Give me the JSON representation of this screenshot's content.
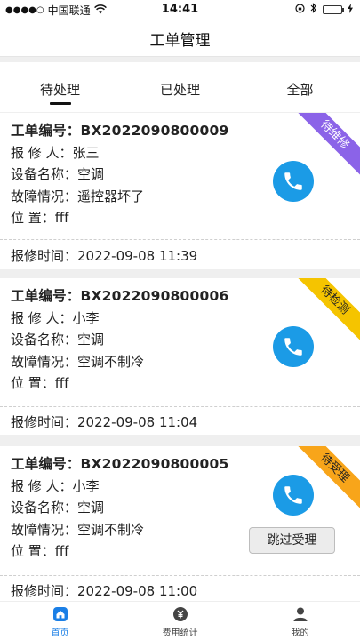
{
  "status_bar": {
    "signal_dots": "●●●●○",
    "carrier": "中国联通",
    "time": "14:41"
  },
  "nav": {
    "title": "工单管理"
  },
  "tabs": [
    {
      "label": "待处理",
      "active": true
    },
    {
      "label": "已处理",
      "active": false
    },
    {
      "label": "全部",
      "active": false
    }
  ],
  "cards": [
    {
      "order_line": "工单编号：BX2022090800009",
      "reporter_line": "报 修 人：张三",
      "device_line": "设备名称：空调",
      "fault_line": "故障情况：遥控器坏了",
      "location_line": "位    置：fff",
      "time_line": "报修时间：2022-09-08 11:39",
      "status": "待维修",
      "status_color": "#8b63e8"
    },
    {
      "order_line": "工单编号：BX2022090800006",
      "reporter_line": "报 修 人：小李",
      "device_line": "设备名称：空调",
      "fault_line": "故障情况：空调不制冷",
      "location_line": "位    置：fff",
      "time_line": "报修时间：2022-09-08 11:04",
      "status": "待检测",
      "status_color": "#f5c400"
    },
    {
      "order_line": "工单编号：BX2022090800005",
      "reporter_line": "报 修 人：小李",
      "device_line": "设备名称：空调",
      "fault_line": "故障情况：空调不制冷",
      "location_line": "位    置：fff",
      "time_line": "报修时间：2022-09-08 11:00",
      "status": "待受理",
      "status_color": "#f8a51a",
      "skip_label": "跳过受理"
    }
  ],
  "tabbar": [
    {
      "label": "首页",
      "icon": "home-icon",
      "active": true
    },
    {
      "label": "费用统计",
      "icon": "yen-coin-icon",
      "active": false
    },
    {
      "label": "我的",
      "icon": "person-icon",
      "active": false
    }
  ],
  "colors": {
    "accent_blue": "#1b9be6",
    "active_tab_blue": "#1b7fe6"
  }
}
